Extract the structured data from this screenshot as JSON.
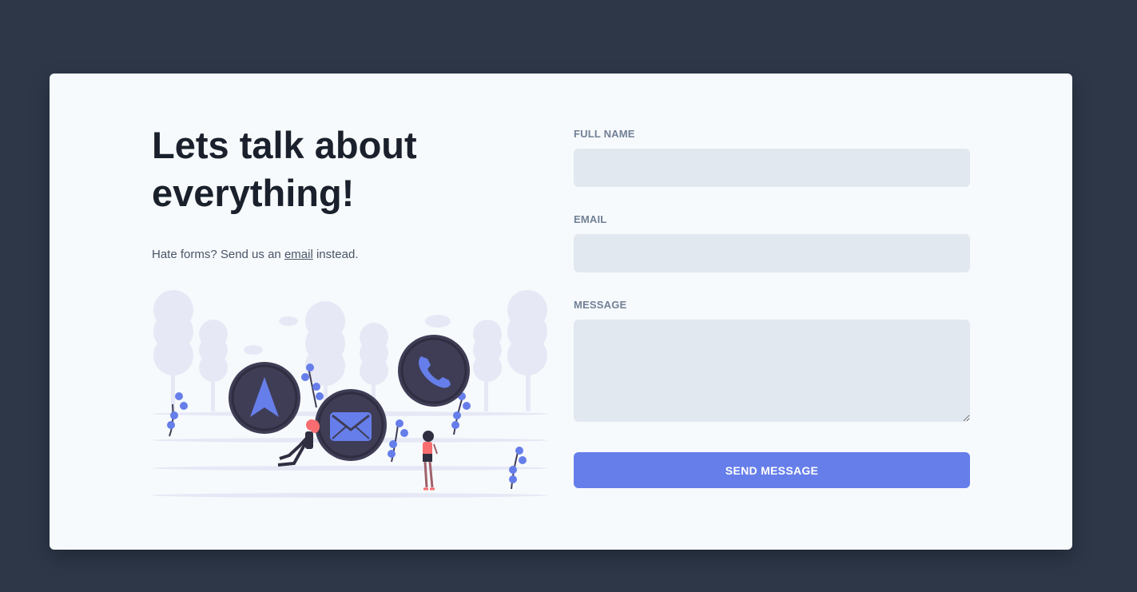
{
  "hero": {
    "headline": "Lets talk about everything!",
    "sub_before": "Hate forms? Send us an ",
    "sub_link": "email",
    "sub_after": " instead."
  },
  "illustration": {
    "icons": [
      "navigation-arrow-icon",
      "envelope-icon",
      "phone-icon"
    ],
    "accent": "#667eea",
    "circle_color": "#3f3d56",
    "tree_color": "#e6e9f5",
    "person_color": "#f86d70"
  },
  "form": {
    "full_name_label": "FULL NAME",
    "full_name_value": "",
    "email_label": "EMAIL",
    "email_value": "",
    "message_label": "MESSAGE",
    "message_value": "",
    "submit_label": "SEND MESSAGE"
  },
  "colors": {
    "background": "#2d3748",
    "card": "#f7fafc",
    "input": "#e2e8f0",
    "button": "#667eea",
    "heading": "#1a202c",
    "label": "#718096"
  }
}
